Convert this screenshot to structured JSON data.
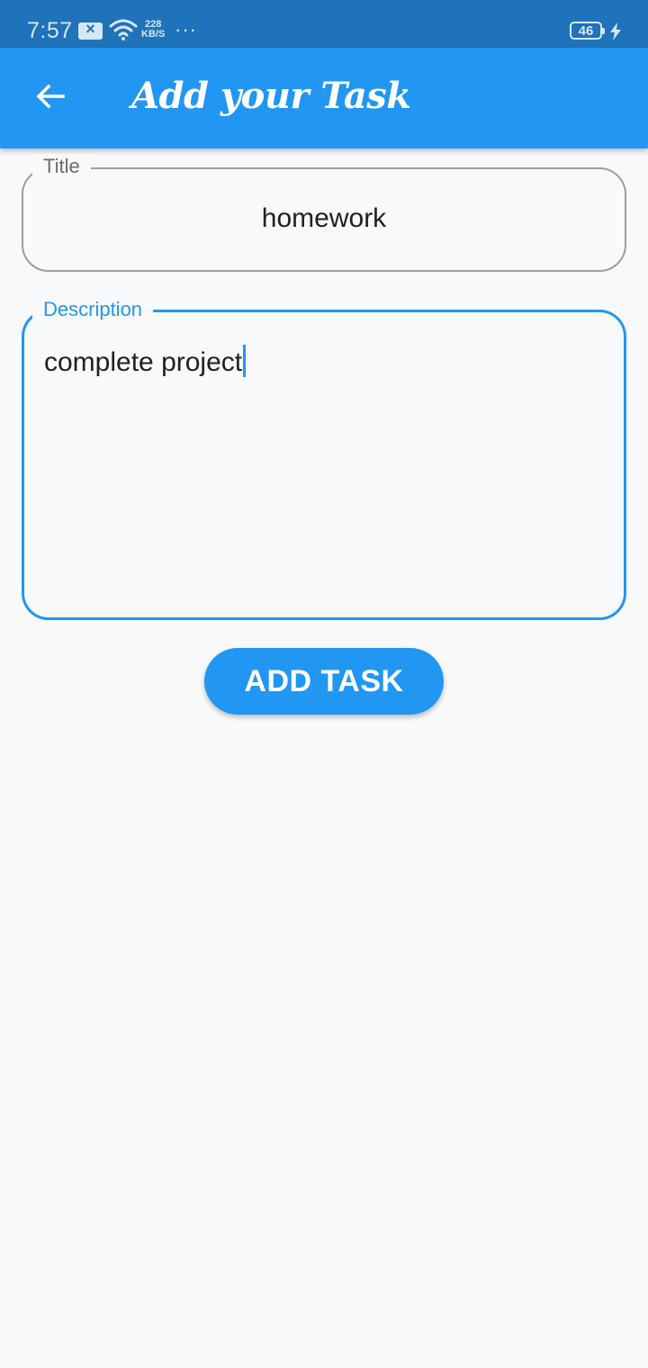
{
  "status_bar": {
    "time": "7:57",
    "speed_value": "228",
    "speed_unit": "KB/S",
    "more": "···",
    "battery": "46",
    "icons": [
      "notification-icon",
      "wifi-icon",
      "battery-icon",
      "charging-icon"
    ]
  },
  "app_bar": {
    "title": "Add your Task",
    "back_icon": "arrow-back-icon"
  },
  "form": {
    "title_field": {
      "label": "Title",
      "value": "homework"
    },
    "description_field": {
      "label": "Description",
      "value": "complete project"
    }
  },
  "actions": {
    "add_task_label": "ADD TASK"
  },
  "colors": {
    "primary": "#2196f3",
    "status_bar": "#1e73ba",
    "background": "#f8f9fa",
    "outline_inactive": "#9e9e9e"
  }
}
